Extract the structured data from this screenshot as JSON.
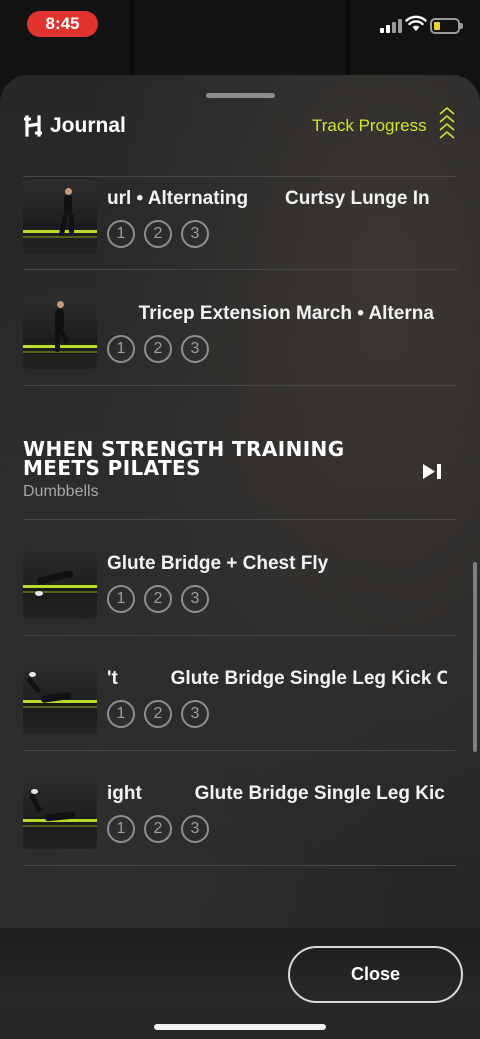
{
  "status_bar": {
    "time": "8:45"
  },
  "header": {
    "title": "Journal",
    "track_progress": "Track Progress"
  },
  "exercises_top": [
    {
      "name": "url • Alternating       Curtsy Lunge In",
      "sets": [
        "1",
        "2",
        "3"
      ]
    },
    {
      "name": "      Tricep Extension March • Alterna",
      "sets": [
        "1",
        "2",
        "3"
      ]
    }
  ],
  "section": {
    "title": "WHEN STRENGTH TRAINING MEETS PILATES",
    "subtitle": "Dumbbells"
  },
  "exercises_bottom": [
    {
      "name": "Glute Bridge + Chest Fly",
      "sets": [
        "1",
        "2",
        "3"
      ]
    },
    {
      "name": "'t          Glute Bridge Single Leg Kick C",
      "sets": [
        "1",
        "2",
        "3"
      ]
    },
    {
      "name": "ight          Glute Bridge Single Leg Kic",
      "sets": [
        "1",
        "2",
        "3"
      ]
    }
  ],
  "footer": {
    "close_label": "Close"
  },
  "colors": {
    "accent": "#cde82c",
    "status_pill": "#e0332e"
  }
}
